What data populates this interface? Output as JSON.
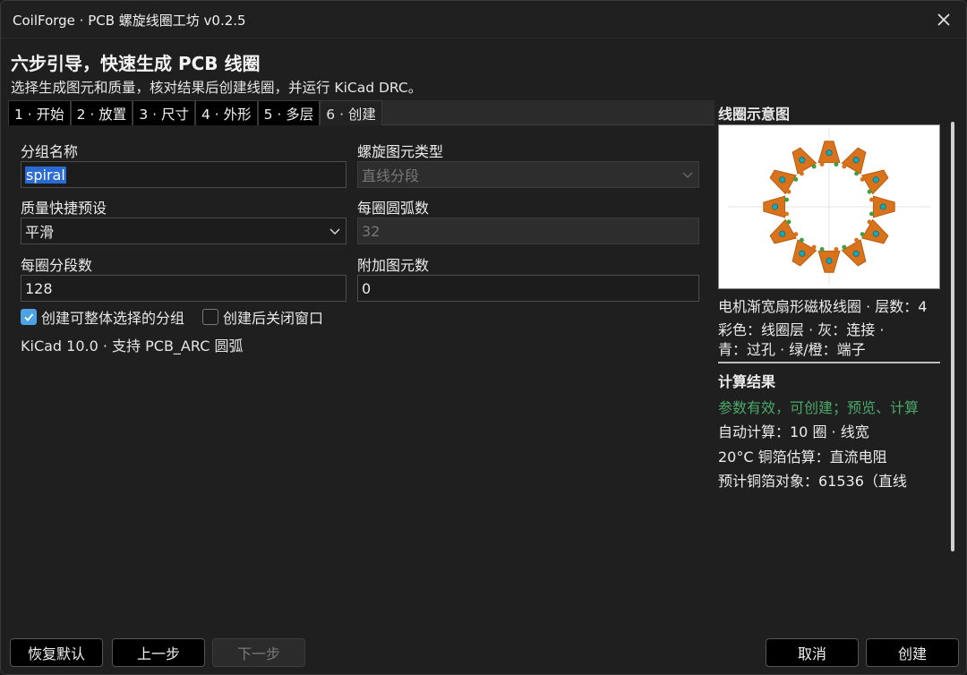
{
  "window": {
    "title": "CoilForge · PCB 螺旋线圈工坊 v0.2.5"
  },
  "header": {
    "title": "六步引导，快速生成 PCB 线圈",
    "subtitle": "选择生成图元和质量，核对结果后创建线圈，并运行 KiCad DRC。"
  },
  "tabs": [
    {
      "label": "1 · 开始",
      "active": false
    },
    {
      "label": "2 · 放置",
      "active": false
    },
    {
      "label": "3 · 尺寸",
      "active": false
    },
    {
      "label": "4 · 外形",
      "active": false
    },
    {
      "label": "5 · 多层",
      "active": false
    },
    {
      "label": "6 · 创建",
      "active": true
    }
  ],
  "form": {
    "group_name": {
      "label": "分组名称",
      "value": "spiral"
    },
    "element_type": {
      "label": "螺旋图元类型",
      "value": "直线分段"
    },
    "quality_preset": {
      "label": "质量快捷预设",
      "value": "平滑"
    },
    "arcs_per_turn": {
      "label": "每圈圆弧数",
      "value": "32"
    },
    "segments_per_turn": {
      "label": "每圈分段数",
      "value": "128"
    },
    "extra_elements": {
      "label": "附加图元数",
      "value": "0"
    },
    "check_group": {
      "label": "创建可整体选择的分组",
      "checked": true
    },
    "check_close": {
      "label": "创建后关闭窗口",
      "checked": false
    },
    "version_note": "KiCad 10.0 · 支持 PCB_ARC 圆弧"
  },
  "preview": {
    "title": "线圈示意图",
    "caption1": "电机渐宽扇形磁极线圈 · 层数：4",
    "caption2": "彩色：线圈层 · 灰：连接 ·",
    "caption3": "青：过孔 · 绿/橙：端子",
    "colors": {
      "coil": "#d9731b",
      "via": "#1aa7b8",
      "terminal_green": "#3f9e3f",
      "connection": "#bdbdbd"
    }
  },
  "results": {
    "title": "计算结果",
    "status": "参数有效，可创建；预览、计算",
    "line1": "自动计算：10 圈 · 线宽",
    "line2": "20°C 铜箔估算：直流电阻",
    "line3": "预计铜箔对象：61536（直线"
  },
  "buttons": {
    "reset": "恢复默认",
    "prev": "上一步",
    "next": "下一步",
    "cancel": "取消",
    "create": "创建"
  }
}
